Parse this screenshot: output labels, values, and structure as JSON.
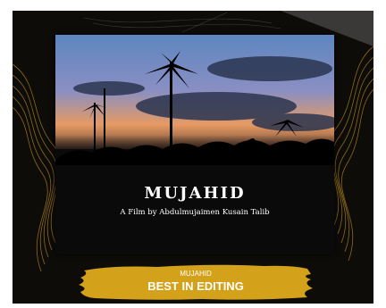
{
  "poster": {
    "title": "MUJAHID",
    "subtitle": "A Film by Abdulmujaimen Kusain Talib"
  },
  "award": {
    "name": "MUJAHID",
    "title": "BEST IN EDITING"
  },
  "colors": {
    "background": "#0e0c09",
    "gold": "#d4a21a",
    "gold_line": "#b8891f",
    "sky_top": "#5d86c0",
    "sunset": "#e79a62"
  }
}
